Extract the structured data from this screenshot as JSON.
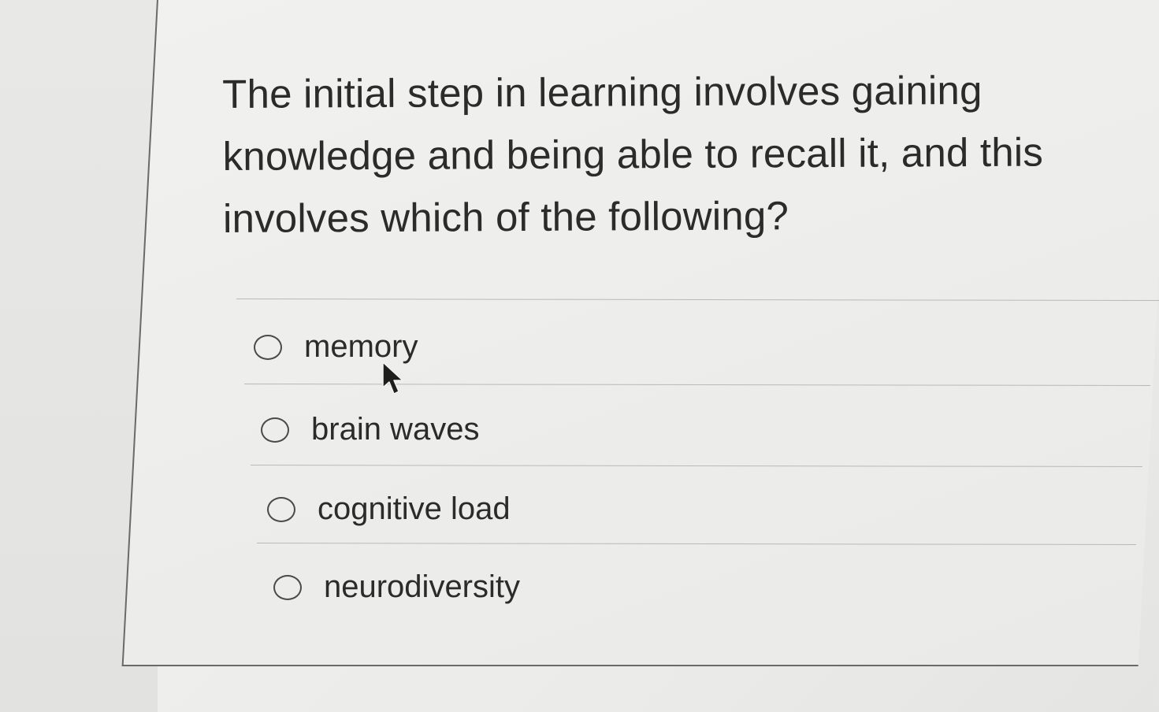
{
  "question": {
    "text": "The initial step in learning involves gaining knowledge and being able to recall it, and this involves which of the following?"
  },
  "options": [
    {
      "label": "memory",
      "selected": false
    },
    {
      "label": "brain waves",
      "selected": false
    },
    {
      "label": "cognitive load",
      "selected": false
    },
    {
      "label": "neurodiversity",
      "selected": false
    }
  ],
  "icons": {
    "cursor": "mouse-pointer-icon"
  }
}
